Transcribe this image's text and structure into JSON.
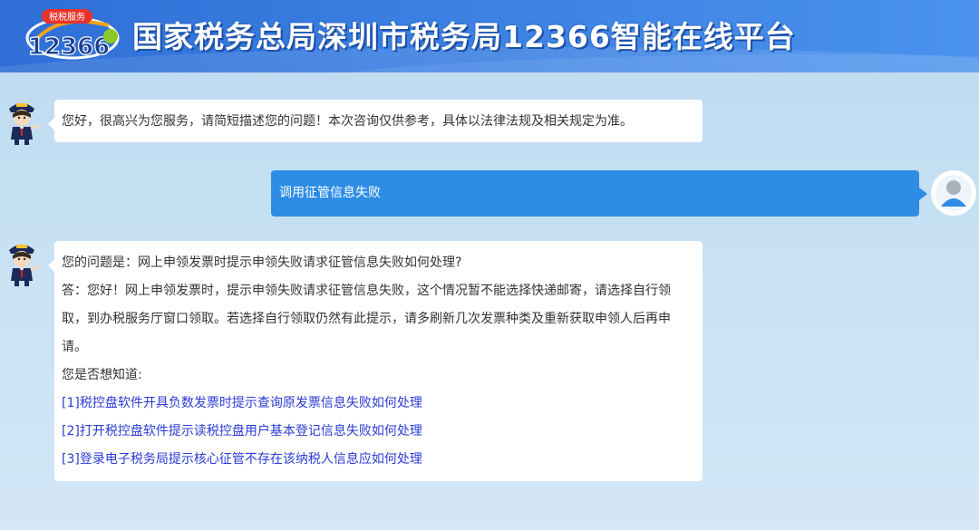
{
  "header": {
    "logo_badge": "税税服务",
    "logo_number": "12366",
    "title": "国家税务总局深圳市税务局12366智能在线平台"
  },
  "messages": {
    "greeting": "您好，很高兴为您服务，请简短描述您的问题！本次咨询仅供参考，具体以法律法规及相关规定为准。",
    "user_query": "调用征管信息失败",
    "answer": {
      "question_line": "您的问题是：网上申领发票时提示申领失败请求征管信息失败如何处理?",
      "answer_text": "答：您好！网上申领发票时，提示申领失败请求征管信息失败，这个情况暂不能选择快递邮寄，请选择自行领取，到办税服务厅窗口领取。若选择自行领取仍然有此提示，请多刷新几次发票种类及重新获取申领人后再申请。",
      "suggest_label": "您是否想知道:",
      "suggestions": [
        "[1]税控盘软件开具负数发票时提示查询原发票信息失败如何处理",
        "[2]打开税控盘软件提示读税控盘用户基本登记信息失败如何处理",
        "[3]登录电子税务局提示核心征管不存在该纳税人信息应如何处理"
      ]
    }
  },
  "icons": {
    "bot": "tax-officer-avatar-icon",
    "user": "user-avatar-icon"
  },
  "colors": {
    "header_bg": "#3b80e2",
    "user_bubble": "#2d8de5",
    "link": "#2a3bd6"
  }
}
